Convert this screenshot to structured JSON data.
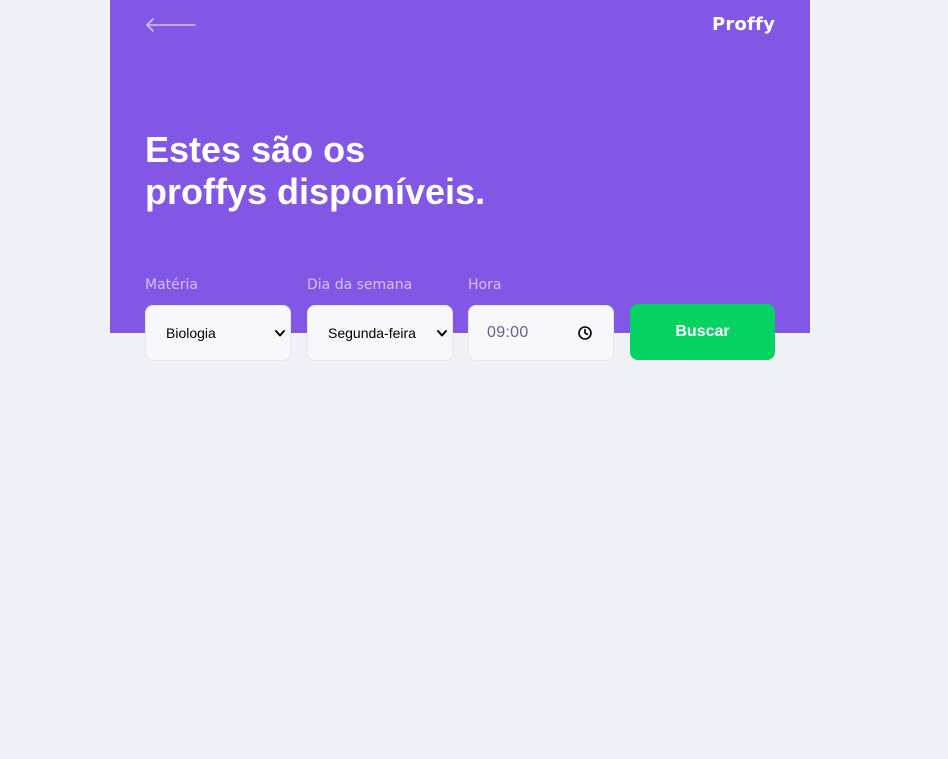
{
  "header": {
    "back_icon": "arrow-left-icon",
    "logo": "Proffy",
    "title_line1": "Estes são os",
    "title_line2": "proffys disponíveis."
  },
  "filters": {
    "subject": {
      "label": "Matéria",
      "value": "Biologia",
      "icon": "chevron-down-icon"
    },
    "weekday": {
      "label": "Dia da semana",
      "value": "Segunda-feira",
      "icon": "chevron-down-icon"
    },
    "time": {
      "label": "Hora",
      "value": "09:00",
      "icon": "clock-icon"
    },
    "submit_label": "Buscar"
  },
  "colors": {
    "primary": "#8257E5",
    "secondary": "#04D361",
    "background": "#F0F0F7",
    "label": "#D4C2FF"
  }
}
